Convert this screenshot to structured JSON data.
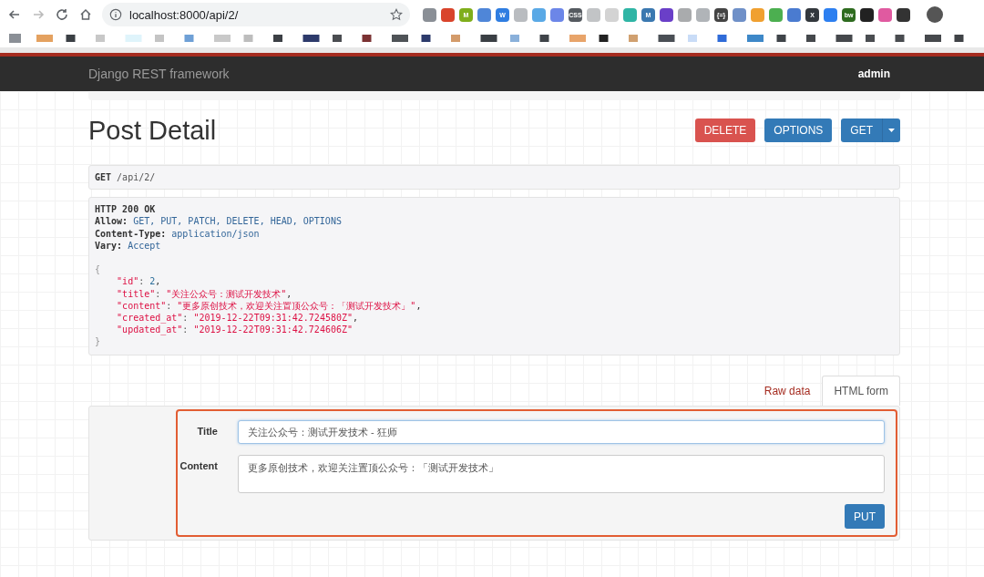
{
  "browser": {
    "url": "localhost:8000/api/2/",
    "extensions": [
      {
        "color": "#8a8f96"
      },
      {
        "color": "#d9442b"
      },
      {
        "color": "#7fae1b",
        "label": "M"
      },
      {
        "color": "#4f86d8"
      },
      {
        "color": "#2f7de1",
        "label": "W"
      },
      {
        "color": "#b9bcc0"
      },
      {
        "color": "#5aa9e6"
      },
      {
        "color": "#6c86e8"
      },
      {
        "color": "#555a60",
        "label": "CSS"
      },
      {
        "color": "#c2c4c6"
      },
      {
        "color": "#d3d3d3"
      },
      {
        "color": "#2fb5a5"
      },
      {
        "color": "#3b78b0",
        "label": "M"
      },
      {
        "color": "#6a3fc8"
      },
      {
        "color": "#a9abad"
      },
      {
        "color": "#b0b4b8"
      },
      {
        "color": "#444444",
        "label": "{=}"
      },
      {
        "color": "#6f90c8"
      },
      {
        "color": "#f0a030"
      },
      {
        "color": "#4caf50"
      },
      {
        "color": "#4a7bd0"
      },
      {
        "color": "#33383d",
        "label": "X"
      },
      {
        "color": "#2d7ff0"
      },
      {
        "color": "#2e6b1f",
        "label": "bw"
      },
      {
        "color": "#222222"
      },
      {
        "color": "#e05aa0"
      },
      {
        "color": "#333333"
      }
    ]
  },
  "navbar": {
    "brand": "Django REST framework",
    "user": "admin"
  },
  "page": {
    "title": "Post Detail",
    "actions": [
      {
        "label": "DELETE",
        "kind": "danger"
      },
      {
        "label": "OPTIONS",
        "kind": "primary"
      },
      {
        "label": "GET",
        "kind": "split"
      }
    ]
  },
  "request": {
    "method": "GET",
    "path": "/api/2/"
  },
  "response": {
    "status": "HTTP 200 OK",
    "headers": [
      {
        "name": "Allow:",
        "value": "GET, PUT, PATCH, DELETE, HEAD, OPTIONS"
      },
      {
        "name": "Content-Type:",
        "value": "application/json"
      },
      {
        "name": "Vary:",
        "value": "Accept"
      }
    ],
    "open": "{",
    "body": [
      {
        "key": "\"id\"",
        "colon": ":",
        "value": "2",
        "kind": "number",
        "sep": ","
      },
      {
        "key": "\"title\"",
        "colon": ":",
        "value": "\"关注公众号：测试开发技术\"",
        "kind": "string",
        "sep": ","
      },
      {
        "key": "\"content\"",
        "colon": ":",
        "value": "\"更多原创技术，欢迎关注置顶公众号：「测试开发技术」\"",
        "kind": "string",
        "sep": ","
      },
      {
        "key": "\"created_at\"",
        "colon": ":",
        "value": "\"2019-12-22T09:31:42.724580Z\"",
        "kind": "string",
        "sep": ","
      },
      {
        "key": "\"updated_at\"",
        "colon": ":",
        "value": "\"2019-12-22T09:31:42.724606Z\"",
        "kind": "string"
      }
    ],
    "close": "}"
  },
  "form_tabs": [
    {
      "label": "Raw data",
      "selected": false
    },
    {
      "label": "HTML form",
      "selected": true
    }
  ],
  "form": {
    "highlighted": true,
    "fields": [
      {
        "label": "Title",
        "value": "关注公众号：测试开发技术 - 狂师",
        "kind": "input",
        "focused": true
      },
      {
        "label": "Content",
        "value": "更多原创技术，欢迎关注置顶公众号：「测试开发技术」",
        "kind": "textarea",
        "focused": false
      }
    ],
    "submit": "PUT"
  }
}
